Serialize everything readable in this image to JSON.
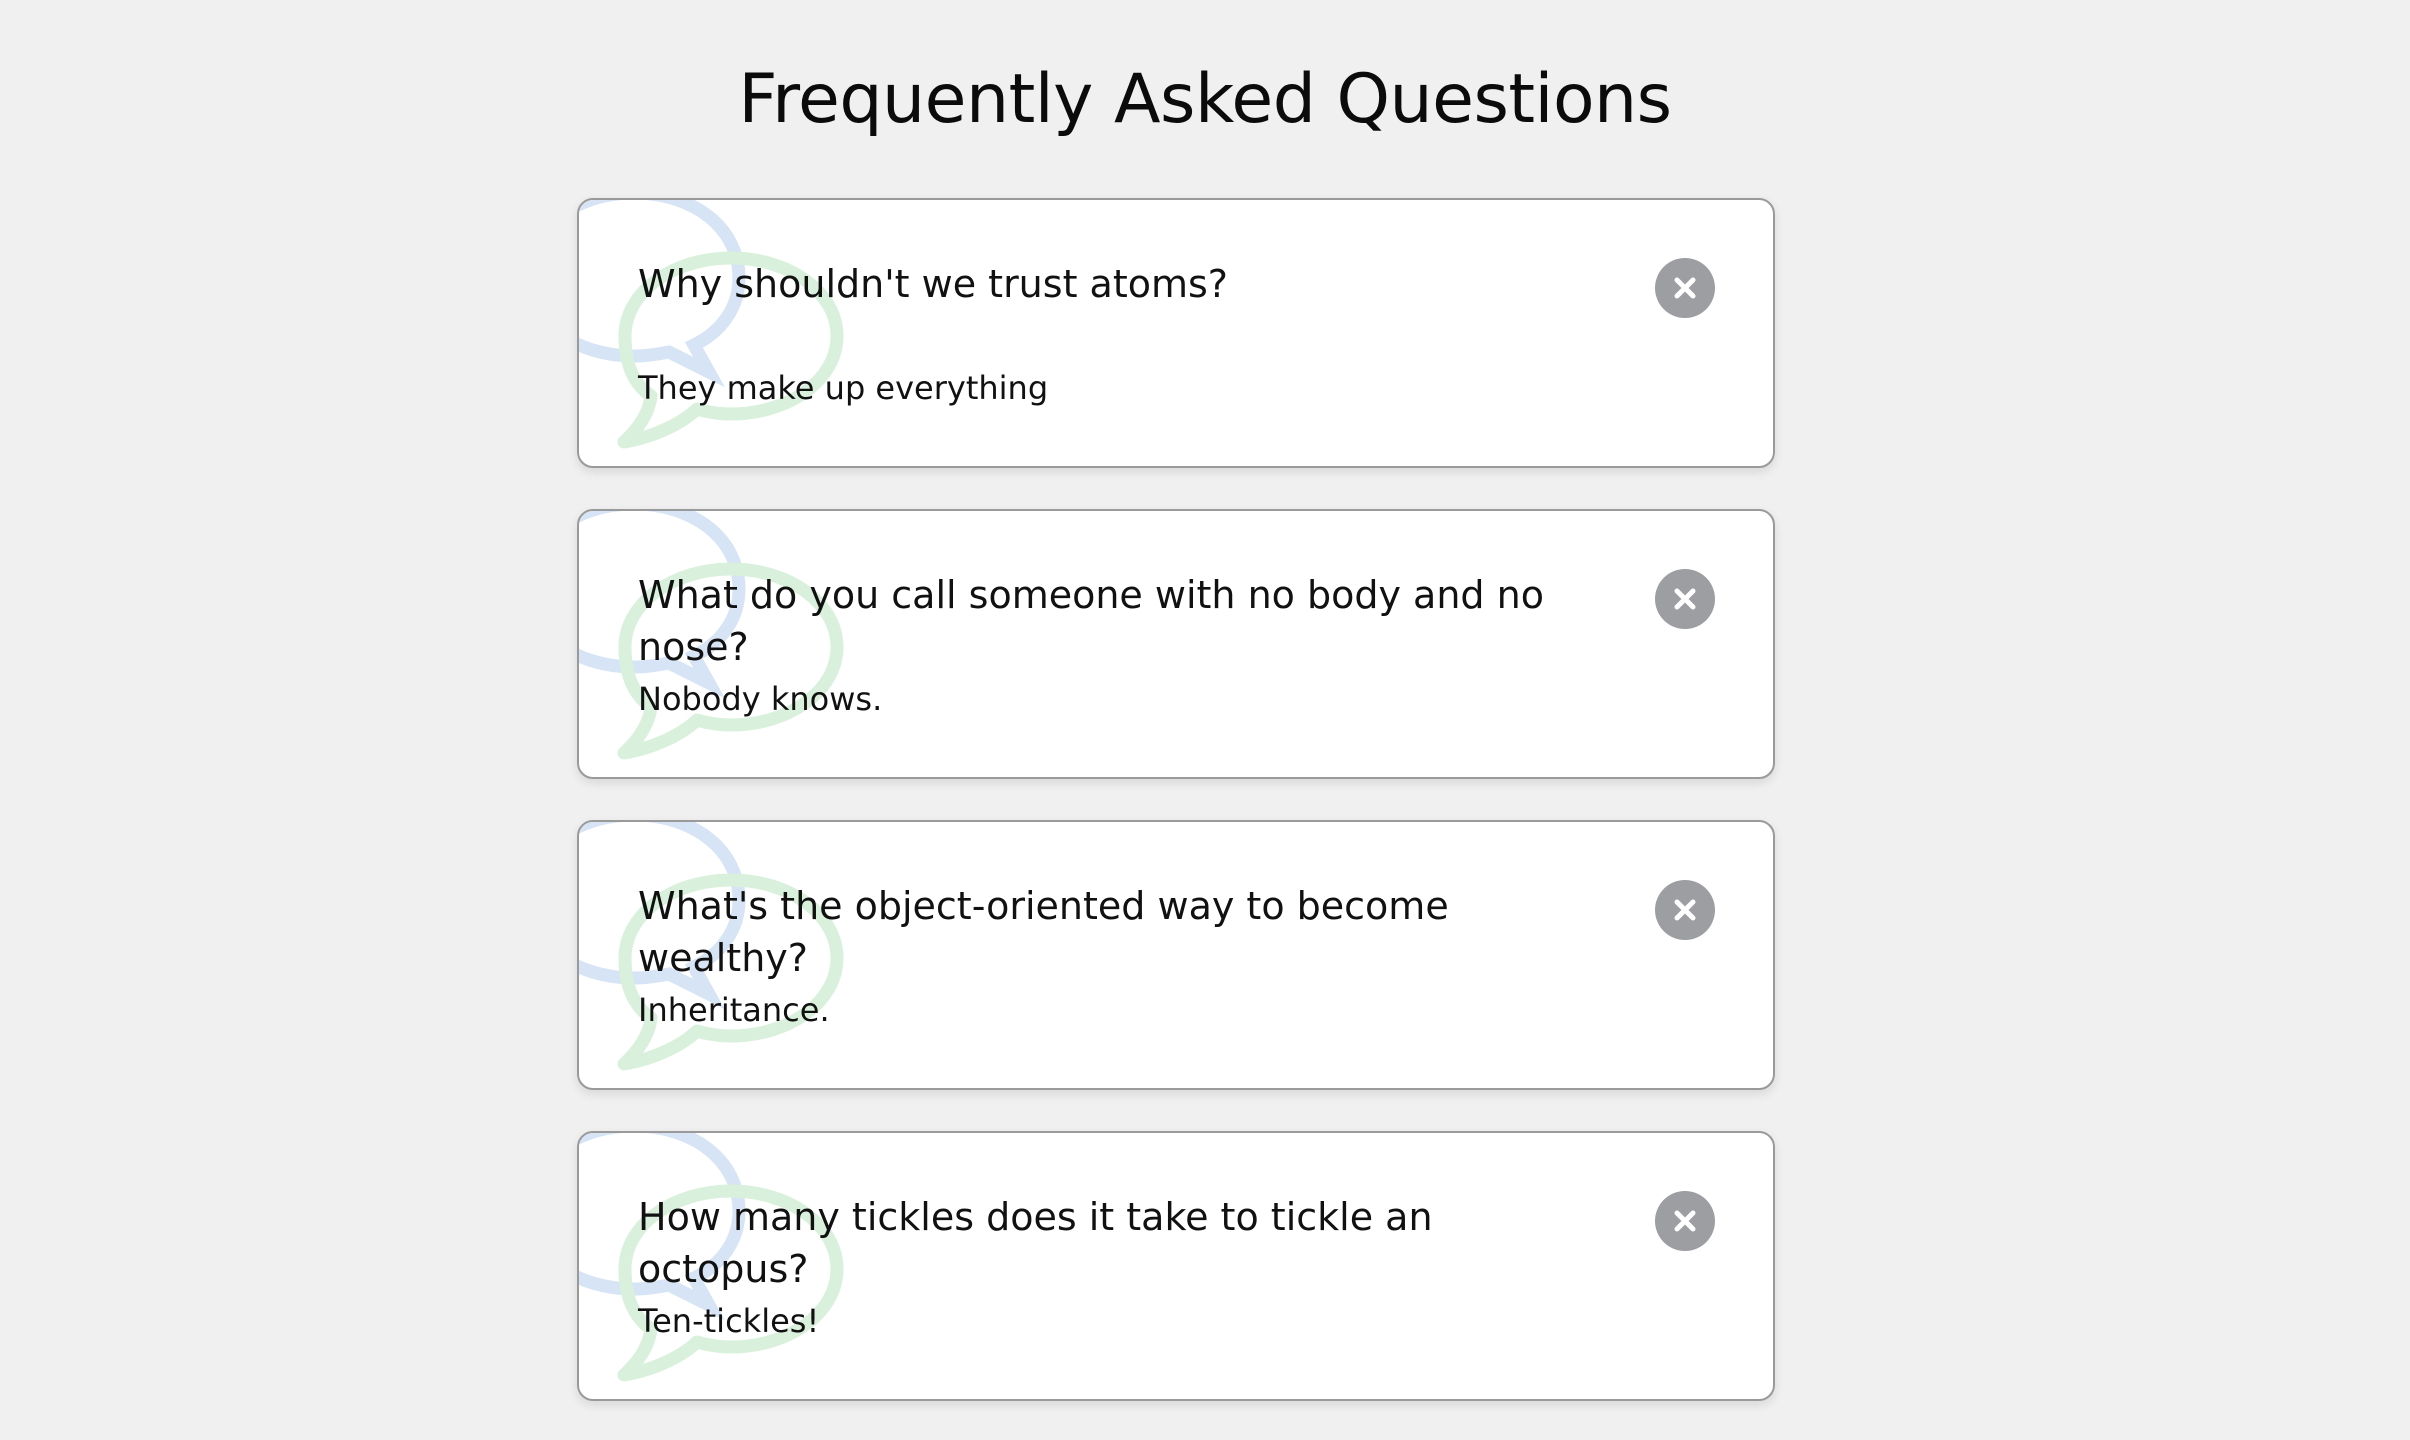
{
  "page": {
    "title": "Frequently Asked Questions"
  },
  "colors": {
    "background": "#f0f0f0",
    "card": "#ffffff",
    "card_border": "#9a9a9a",
    "toggle_button": "#9c9ea2",
    "bubble_blue": "#d6e4f5",
    "bubble_green": "#d9f1dc"
  },
  "faqs": [
    {
      "question": "Why shouldn't we trust atoms?",
      "answer": "They make up everything",
      "toggle_icon": "close-icon"
    },
    {
      "question": "What do you call someone with no body and no nose?",
      "answer": "Nobody knows.",
      "toggle_icon": "close-icon"
    },
    {
      "question": "What's the object-oriented way to become wealthy?",
      "answer": "Inheritance.",
      "toggle_icon": "close-icon"
    },
    {
      "question": "How many tickles does it take to tickle an octopus?",
      "answer": "Ten-tickles!",
      "toggle_icon": "close-icon"
    }
  ]
}
